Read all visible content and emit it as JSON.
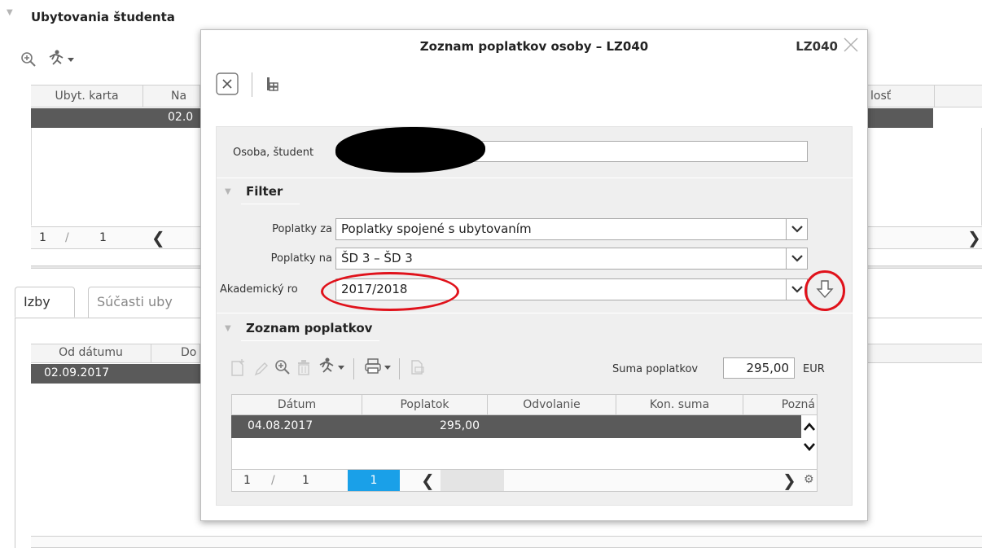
{
  "background": {
    "section_title": "Ubytovania študenta",
    "grid_headers": [
      "Ubyt. karta",
      "Na",
      "losť"
    ],
    "grid_selected_partial": "02.0",
    "pager": {
      "page": "1",
      "sep": "/",
      "total": "1"
    },
    "tabs": [
      "Izby",
      "Súčasti uby"
    ],
    "lower_grid_headers": [
      "Od dátumu",
      "Do"
    ],
    "lower_grid_selected": "02.09.2017"
  },
  "dialog": {
    "title": "Zoznam poplatkov osoby – LZ040",
    "code": "LZ040",
    "person_label": "Osoba, študent",
    "person_value": "",
    "filter_title": "Filter",
    "fees_for_label": "Poplatky za",
    "fees_for_value": "Poplatky spojené s ubytovaním",
    "fees_on_label": "Poplatky na",
    "fees_on_value": "ŠD 3 – ŠD 3",
    "academic_year_label": "Akademický ro",
    "academic_year_value": "2017/2018",
    "list_title": "Zoznam poplatkov",
    "sum_label": "Suma poplatkov",
    "sum_value": "295,00",
    "currency": "EUR",
    "grid": {
      "headers": [
        "Dátum",
        "Poplatok",
        "Odvolanie",
        "Kon. suma",
        "Pozná"
      ],
      "rows": [
        {
          "date": "04.08.2017",
          "fee": "295,00"
        }
      ]
    },
    "pager": {
      "page": "1",
      "sep": "/",
      "total": "1",
      "current": "1"
    }
  },
  "colors": {
    "selected_row": "#5a5a5a",
    "annotation_red": "#e0121b",
    "pager_active": "#1aa0e8"
  }
}
